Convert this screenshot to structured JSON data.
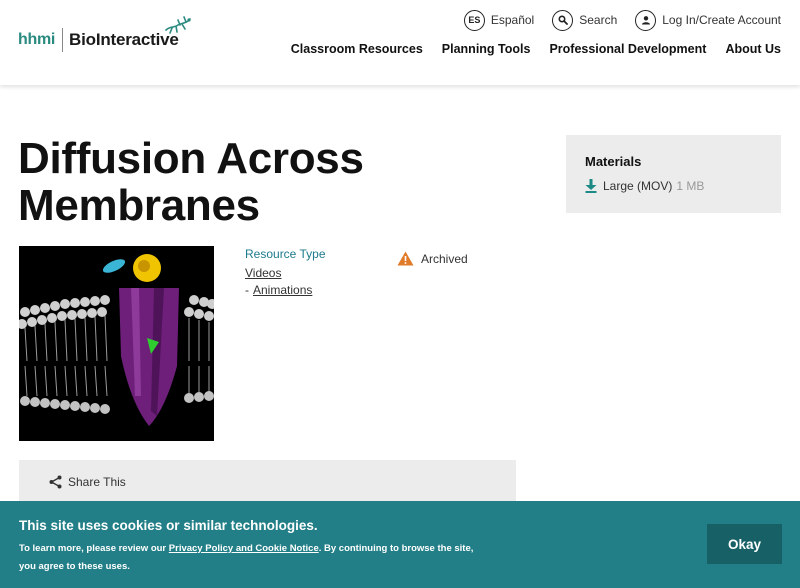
{
  "logo": {
    "hhmi": "hhmi",
    "brand": "BioInteractive"
  },
  "utility": {
    "espanol": {
      "badge": "ES",
      "label": "Español"
    },
    "search": {
      "label": "Search"
    },
    "login": {
      "label": "Log In/Create Account"
    }
  },
  "nav": [
    {
      "label": "Classroom Resources"
    },
    {
      "label": "Planning Tools"
    },
    {
      "label": "Professional Development"
    },
    {
      "label": "About Us"
    }
  ],
  "page": {
    "title_line1": "Diffusion Across",
    "title_line2": "Membranes"
  },
  "resource": {
    "type_label": "Resource Type",
    "types": [
      "Videos",
      "Animations"
    ],
    "separator": "-",
    "status": "Archived"
  },
  "materials": {
    "title": "Materials",
    "items": [
      {
        "name": "Large (MOV)",
        "size": "1 MB"
      }
    ]
  },
  "share": {
    "label": "Share This"
  },
  "cookie": {
    "title": "This site uses cookies or similar technologies.",
    "text_before": "To learn more, please review our ",
    "link": "Privacy Policy and Cookie Notice",
    "text_after": ". By continuing to browse the site, you agree to these uses.",
    "button": "Okay"
  },
  "colors": {
    "teal": "#237f87",
    "teal_dark": "#176066",
    "link_teal": "#1d7a8c",
    "warning": "#e07b2a",
    "download": "#1d8a86"
  }
}
